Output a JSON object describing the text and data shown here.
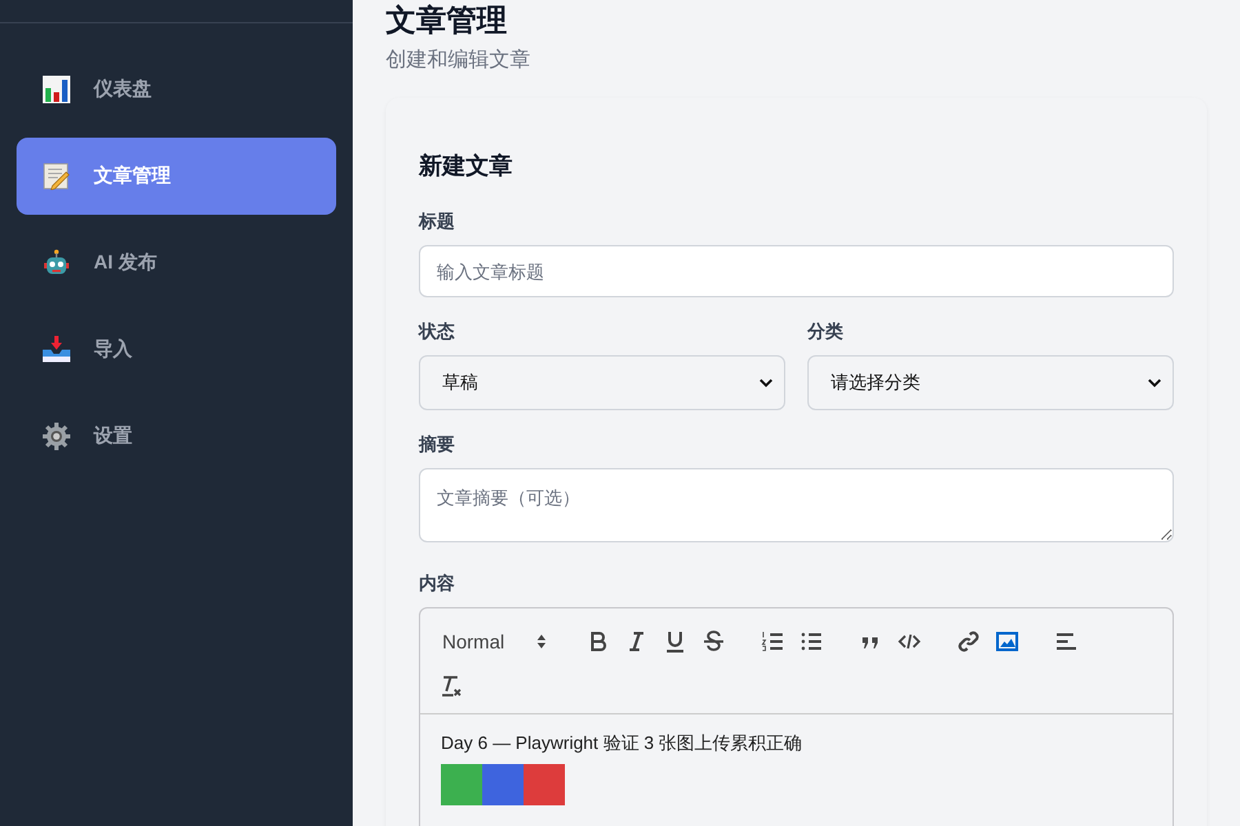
{
  "sidebar": {
    "items": [
      {
        "label": "仪表盘",
        "selected": false
      },
      {
        "label": "文章管理",
        "selected": true
      },
      {
        "label": "AI 发布",
        "selected": false
      },
      {
        "label": "导入",
        "selected": false
      },
      {
        "label": "设置",
        "selected": false
      }
    ]
  },
  "page": {
    "title": "文章管理",
    "subtitle": "创建和编辑文章"
  },
  "form": {
    "heading": "新建文章",
    "title_field": {
      "label": "标题",
      "placeholder": "输入文章标题"
    },
    "status_field": {
      "label": "状态",
      "value": "草稿"
    },
    "category_field": {
      "label": "分类",
      "value": "请选择分类"
    },
    "summary_field": {
      "label": "摘要",
      "placeholder": "文章摘要（可选）"
    },
    "content": {
      "label": "内容",
      "editor": {
        "header_format": "Normal",
        "toolbar": [
          {
            "buttons": [
              {
                "kind": "bold",
                "active": false
              },
              {
                "kind": "italic",
                "active": false
              },
              {
                "kind": "underline",
                "active": false
              },
              {
                "kind": "strike",
                "active": false
              }
            ]
          },
          {
            "buttons": [
              {
                "kind": "ordered-list",
                "active": false
              },
              {
                "kind": "bullet-list",
                "active": false
              }
            ]
          },
          {
            "buttons": [
              {
                "kind": "blockquote",
                "active": false
              },
              {
                "kind": "code",
                "active": false
              }
            ]
          },
          {
            "buttons": [
              {
                "kind": "link",
                "active": false
              },
              {
                "kind": "image",
                "active": true
              }
            ]
          },
          {
            "buttons": [
              {
                "kind": "align",
                "active": false
              }
            ]
          },
          {
            "buttons": [
              {
                "kind": "clean",
                "active": false
              }
            ]
          }
        ],
        "text": "Day 6 — Playwright 验证 3 张图上传累积正确",
        "images": [
          {
            "color": "#3cb04f"
          },
          {
            "color": "#3e64de"
          },
          {
            "color": "#dd3c3c"
          }
        ]
      }
    }
  }
}
